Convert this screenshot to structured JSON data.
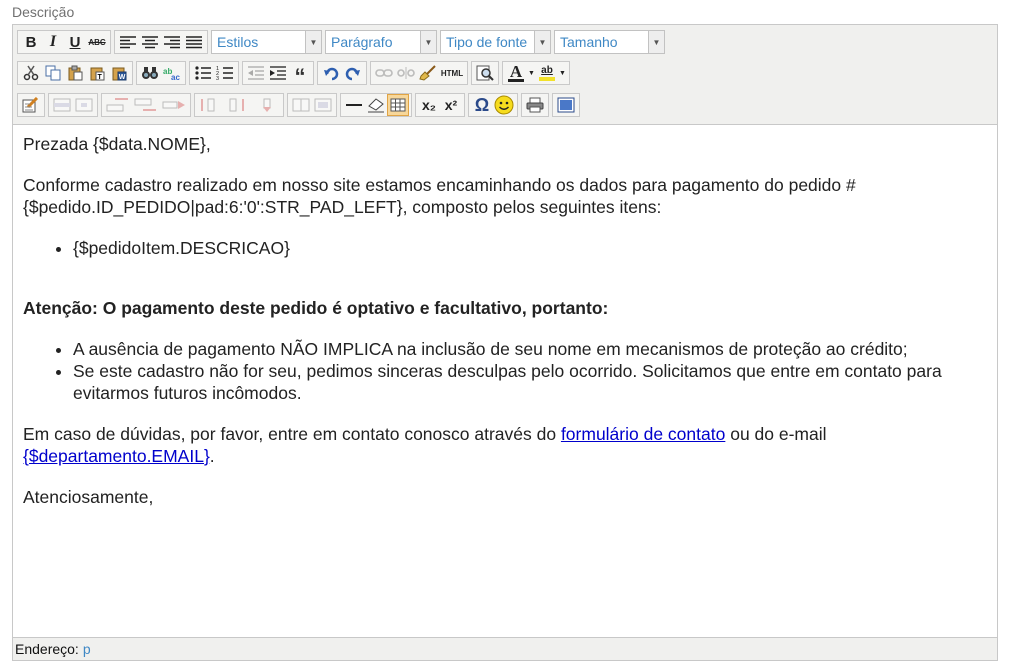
{
  "field_label": "Descrição",
  "toolbar": {
    "selects": {
      "styles": "Estilos",
      "format": "Parágrafo",
      "font_family": "Tipo de fonte",
      "font_size": "Tamanho"
    },
    "text_buttons": {
      "bold": "B",
      "italic": "I",
      "underline": "U",
      "strikethrough": "ABC",
      "blockquote": "“",
      "html": "HTML",
      "font_color": "A",
      "highlight": "ab",
      "subscript": "x₂",
      "superscript": "x²",
      "special_char": "Ω"
    },
    "icons": {
      "cut": "scissors-icon",
      "copy": "copy-icon",
      "paste": "paste-icon",
      "paste_text": "paste-text-icon",
      "paste_word": "paste-word-icon",
      "find": "binoculars-icon",
      "replace": "replace-icon",
      "bullet_list": "bullet-list-icon",
      "numbered_list": "numbered-list-icon",
      "outdent": "outdent-icon",
      "indent": "indent-icon",
      "undo": "undo-icon",
      "redo": "redo-icon",
      "link": "link-icon",
      "unlink": "unlink-icon",
      "cleanup": "broom-icon",
      "preview": "preview-icon",
      "edit": "edit-icon",
      "horizontal_rule": "horizontal-rule-icon",
      "remove_format": "eraser-icon",
      "visual_aid": "table-grid-icon",
      "emoticon": "smiley-icon",
      "print": "print-icon",
      "fullscreen": "fullscreen-icon"
    },
    "accent_color": "#f7d79a"
  },
  "content": {
    "greeting": "Prezada {$data.NOME},",
    "intro": "Conforme cadastro realizado em nosso site estamos encaminhando os dados para pagamento do pedido # {$pedido.ID_PEDIDO|pad:6:'0':STR_PAD_LEFT}, composto pelos seguintes itens:",
    "items": [
      "{$pedidoItem.DESCRICAO}"
    ],
    "attention": "Atenção: O pagamento deste pedido é optativo e facultativo, portanto:",
    "notes": [
      "A ausência de pagamento NÃO IMPLICA na inclusão de seu nome em mecanismos de proteção ao crédito;",
      "Se este cadastro não for seu, pedimos sinceras desculpas pelo ocorrido. Solicitamos que entre em contato para evitarmos futuros incômodos."
    ],
    "contact_before": "Em caso de dúvidas, por favor, entre em contato conosco através do ",
    "contact_link": "formulário de contato",
    "contact_middle": " ou do e-mail ",
    "contact_email": "{$departamento.EMAIL}",
    "contact_after": ".",
    "closing": "Atenciosamente,",
    "link_color": "#0000cc"
  },
  "statusbar": {
    "label": "Endereço:",
    "path": "p"
  }
}
